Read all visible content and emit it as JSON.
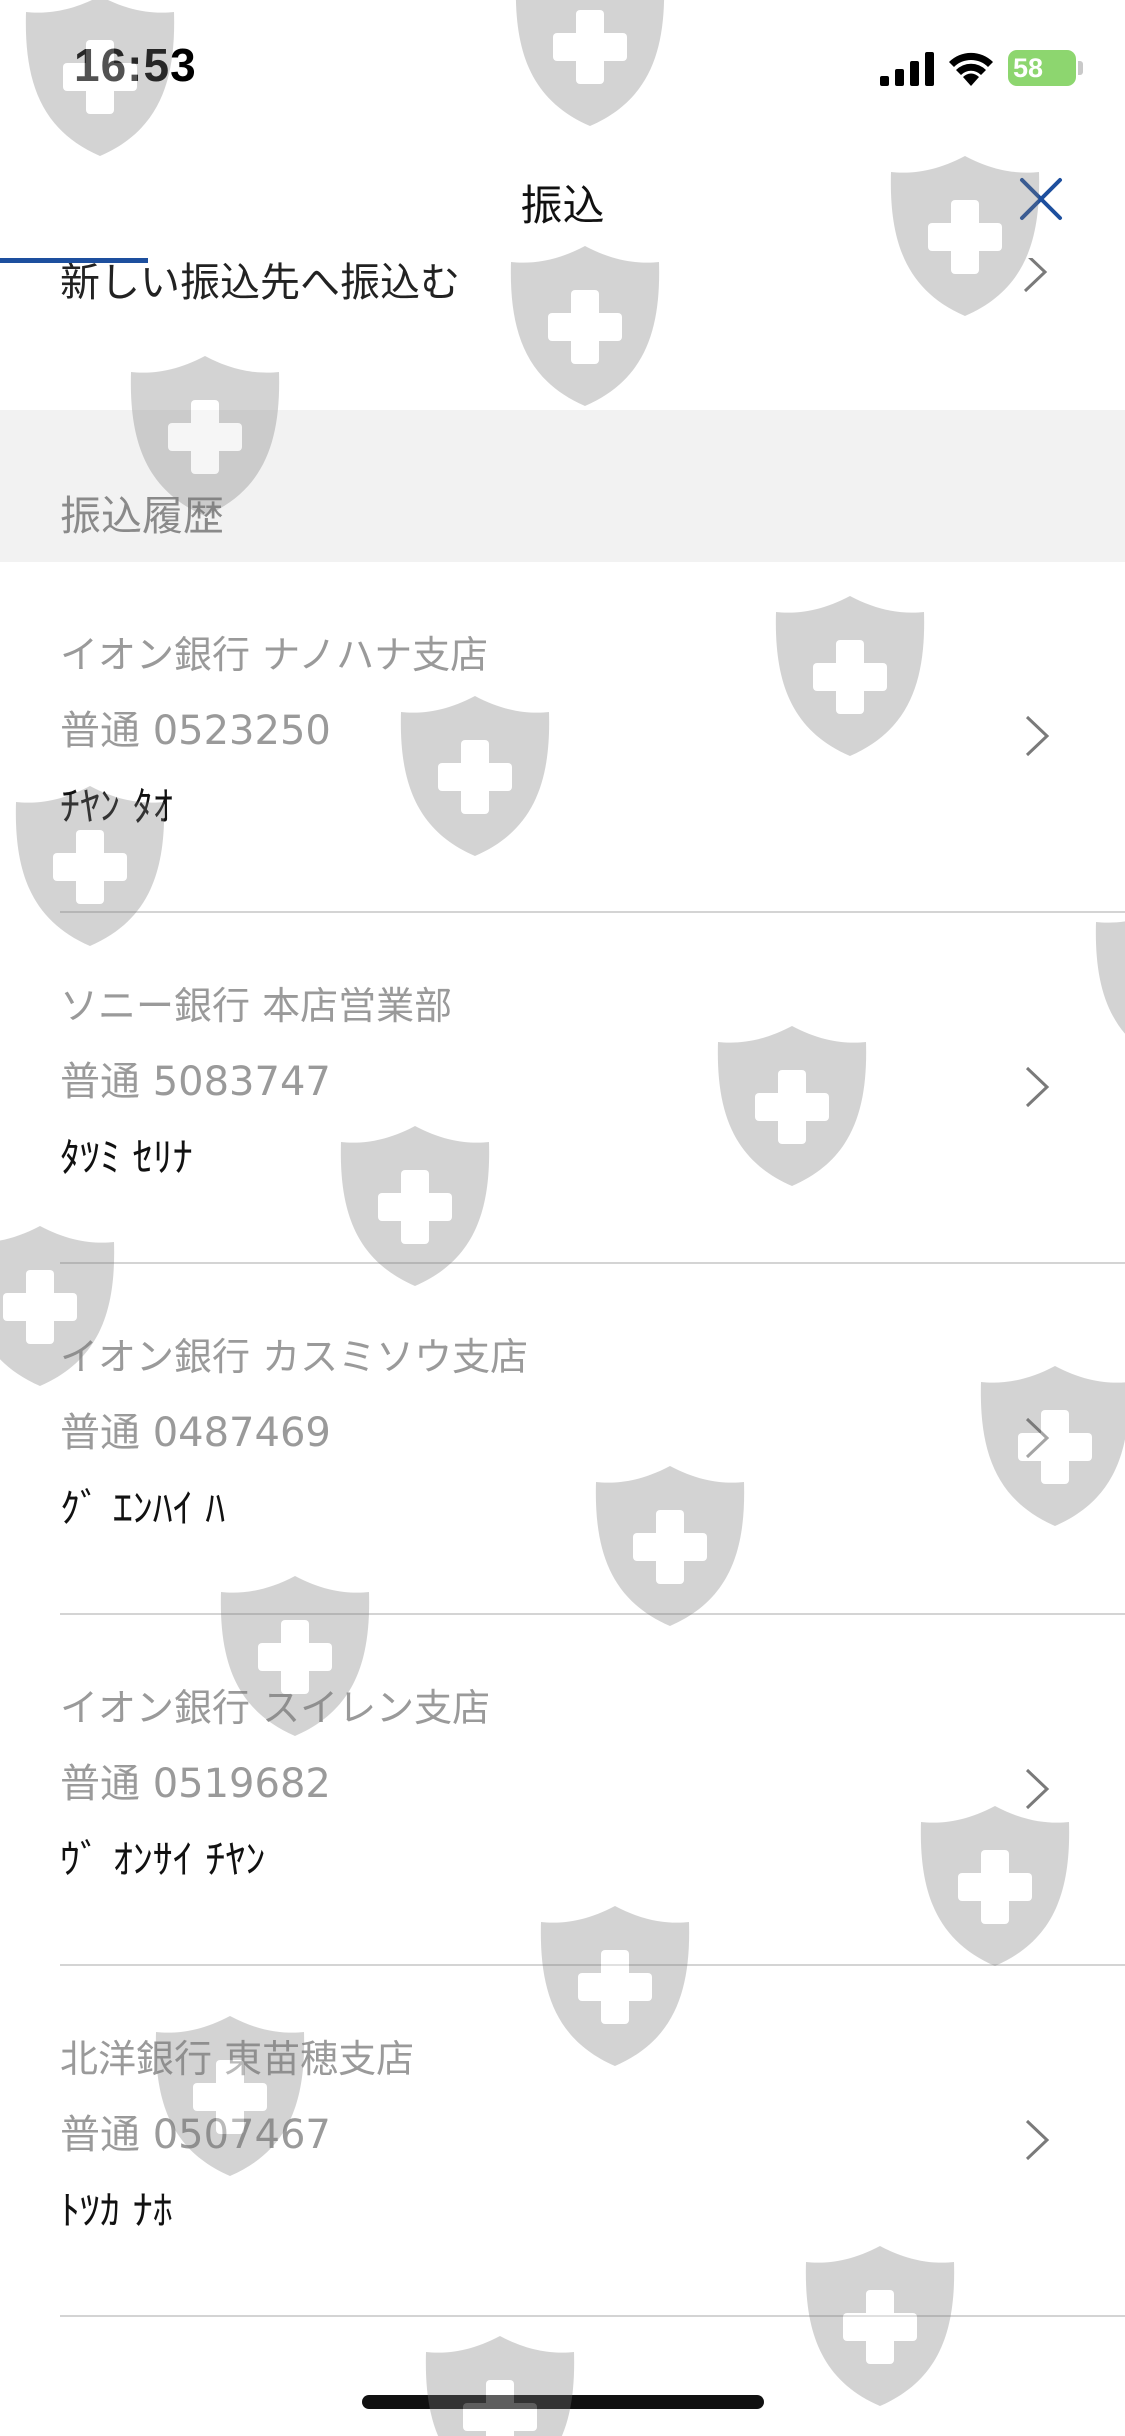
{
  "status_bar": {
    "time": "16:53",
    "battery": "58"
  },
  "nav": {
    "title": "振込"
  },
  "prev_row": {
    "label": "新しい振込先へ振込む"
  },
  "section": {
    "title": "振込履歴"
  },
  "history": [
    {
      "bank": "イオン銀行 ナノハナ支店",
      "account": "普通 0523250",
      "payee": "ﾁﾔﾝ ﾀｵ"
    },
    {
      "bank": "ソニー銀行 本店営業部",
      "account": "普通 5083747",
      "payee": "ﾀﾂﾐ ｾﾘﾅ"
    },
    {
      "bank": "イオン銀行 カスミソウ支店",
      "account": "普通 0487469",
      "payee": "ｸﾞ ｴﾝﾊｲ ﾊ"
    },
    {
      "bank": "イオン銀行 スイレン支店",
      "account": "普通 0519682",
      "payee": "ｳﾞ ｵﾝｻｲ ﾁﾔﾝ"
    },
    {
      "bank": "北洋銀行 東苗穂支店",
      "account": "普通 0507467",
      "payee": "ﾄﾂｶ ﾅﾎ"
    }
  ],
  "colors": {
    "accent": "#1d4f9e",
    "battery": "#8dd66f",
    "section_bg": "#f2f2f2",
    "secondary_text": "#9a9a9a"
  },
  "icons": {
    "signal": "signal-icon",
    "wifi": "wifi-icon",
    "battery": "battery-icon",
    "close": "close-icon",
    "chevron": "chevron-right-icon",
    "watermark": "shield-plus-icon"
  }
}
